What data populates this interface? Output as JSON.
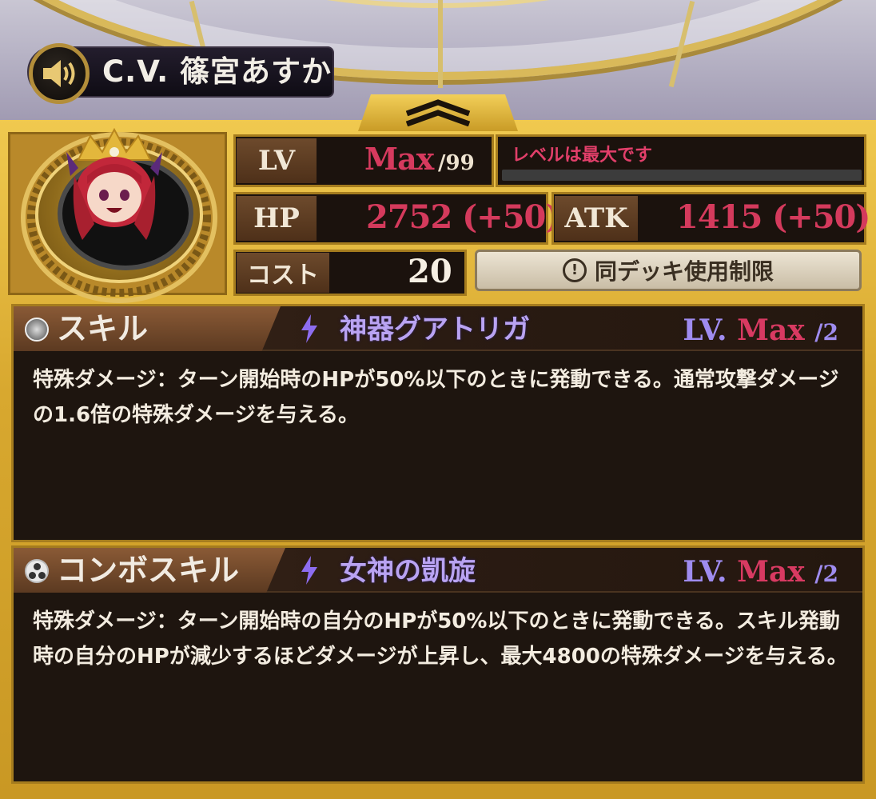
{
  "cv": {
    "label": "C.V. 篠宮あすか",
    "icon": "speaker-icon"
  },
  "stats": {
    "lv_label": "LV",
    "lv_value": "Max",
    "lv_max": "/99",
    "lv_message": "レベルは最大です",
    "hp_label": "HP",
    "hp_value": "2752 (+50)",
    "atk_label": "ATK",
    "atk_value": "1415 (+50)",
    "cost_label": "コスト",
    "cost_value": "20",
    "deck_limit_label": "同デッキ使用制限"
  },
  "skill": {
    "type_label": "スキル",
    "name": "神器グアトリガ",
    "lv_prefix": "LV.",
    "lv_value": "Max",
    "lv_max": "/2",
    "description": "特殊ダメージ：ターン開始時のHPが50%以下のときに発動できる。通常攻撃ダメージの1.6倍の特殊ダメージを与える。"
  },
  "combo_skill": {
    "type_label": "コンボスキル",
    "name": "女神の凱旋",
    "lv_prefix": "LV.",
    "lv_value": "Max",
    "lv_max": "/2",
    "description": "特殊ダメージ：ターン開始時の自分のHPが50%以下のときに発動できる。スキル発動時の自分のHPが減少するほどダメージが上昇し、最大4800の特殊ダメージを与える。"
  },
  "colors": {
    "gold": "#d8a82f",
    "value_red": "#d43a5c",
    "skill_purple": "#b9a3f2",
    "panel_dark": "#1e150f"
  }
}
